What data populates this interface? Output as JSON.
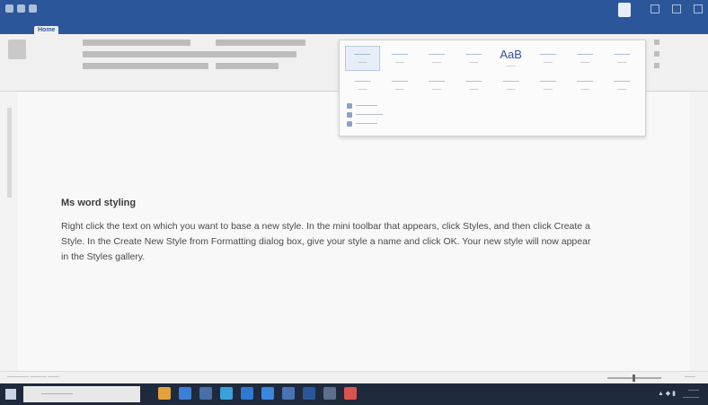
{
  "window": {
    "title": "",
    "user": ""
  },
  "ribbon": {
    "tabs": [
      {
        "label": "Home",
        "active": true
      },
      {
        "label": "",
        "active": false
      },
      {
        "label": "",
        "active": false
      },
      {
        "label": "",
        "active": false
      },
      {
        "label": "",
        "active": false
      },
      {
        "label": "",
        "active": false
      },
      {
        "label": "",
        "active": false
      },
      {
        "label": "",
        "active": false
      },
      {
        "label": "",
        "active": false
      }
    ],
    "styles_gallery": {
      "featured_preview": "AaB",
      "menu_item_count": 3
    }
  },
  "document": {
    "heading": "Ms word styling",
    "body": "Right click the text on which you want to base a new style. In the mini toolbar that appears, click Styles, and then click Create a Style. In the Create New Style from Formatting dialog box, give your style a name and click OK. Your new style will now appear in the Styles gallery."
  },
  "colors": {
    "title_bar": "#2b579a",
    "taskbar": "#1f2a3c",
    "page": "#f8f8f8"
  }
}
